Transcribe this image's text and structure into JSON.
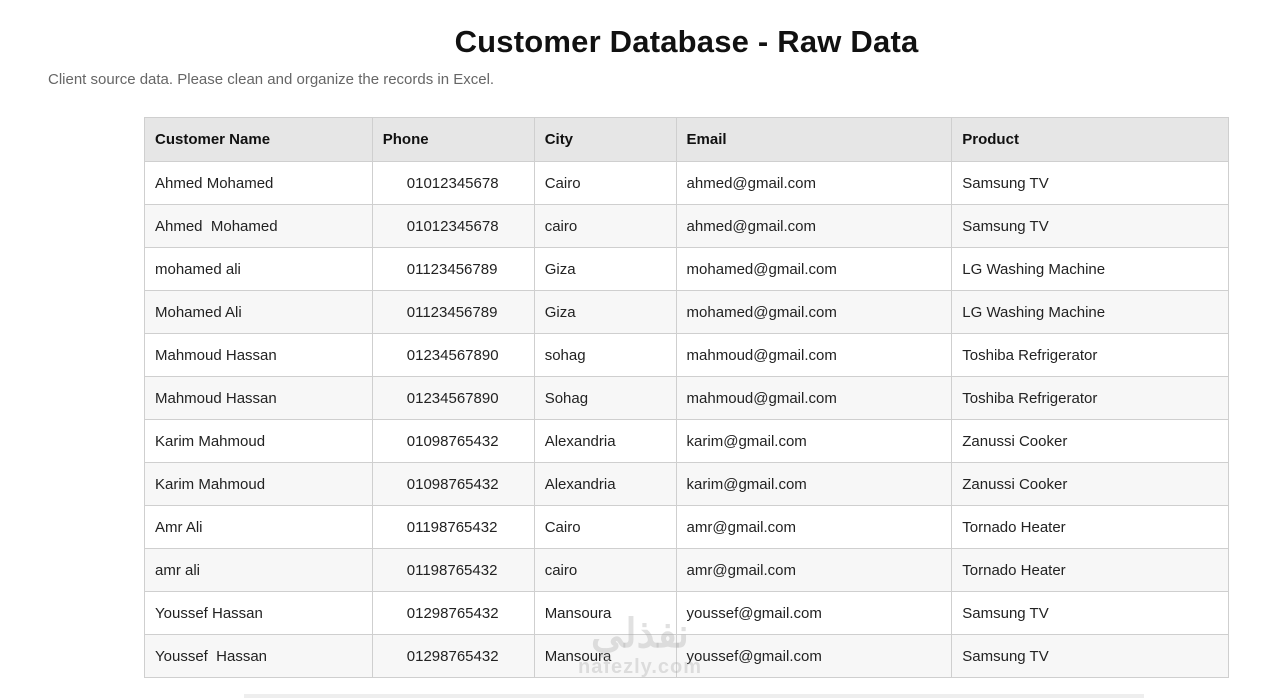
{
  "title": "Customer Database - Raw Data",
  "subtitle": "Client source data. Please clean and organize the records in Excel.",
  "table": {
    "headers": [
      "Customer Name",
      "Phone",
      "City",
      "Email",
      "Product"
    ],
    "rows": [
      [
        "Ahmed Mohamed",
        "01012345678",
        "Cairo",
        "ahmed@gmail.com",
        "Samsung TV"
      ],
      [
        "Ahmed  Mohamed",
        "01012345678",
        "cairo",
        "ahmed@gmail.com",
        "Samsung TV"
      ],
      [
        "mohamed ali",
        "01123456789",
        "Giza",
        "mohamed@gmail.com",
        "LG Washing Machine"
      ],
      [
        "Mohamed Ali",
        "01123456789",
        "Giza",
        "mohamed@gmail.com",
        "LG Washing Machine"
      ],
      [
        "Mahmoud Hassan",
        "01234567890",
        "sohag",
        "mahmoud@gmail.com",
        "Toshiba Refrigerator"
      ],
      [
        "Mahmoud Hassan",
        "01234567890",
        "Sohag",
        "mahmoud@gmail.com",
        "Toshiba Refrigerator"
      ],
      [
        "Karim Mahmoud",
        "01098765432",
        "Alexandria",
        "karim@gmail.com",
        "Zanussi Cooker"
      ],
      [
        "Karim Mahmoud",
        "01098765432",
        "Alexandria",
        "karim@gmail.com",
        "Zanussi Cooker"
      ],
      [
        "Amr Ali",
        "01198765432",
        "Cairo",
        "amr@gmail.com",
        "Tornado Heater"
      ],
      [
        "amr ali",
        "01198765432",
        "cairo",
        "amr@gmail.com",
        "Tornado Heater"
      ],
      [
        "Youssef Hassan",
        "01298765432",
        "Mansoura",
        "youssef@gmail.com",
        "Samsung TV"
      ],
      [
        "Youssef  Hassan",
        "01298765432",
        "Mansoura",
        "youssef@gmail.com",
        "Samsung TV"
      ]
    ]
  },
  "watermark": {
    "arabic": "نفذلي",
    "latin": "nafezly.com"
  },
  "colors": {
    "header_bg": "#e6e6e6",
    "border": "#cfcfcf",
    "alt_row_bg": "#f7f7f7",
    "subtitle": "#666666"
  }
}
